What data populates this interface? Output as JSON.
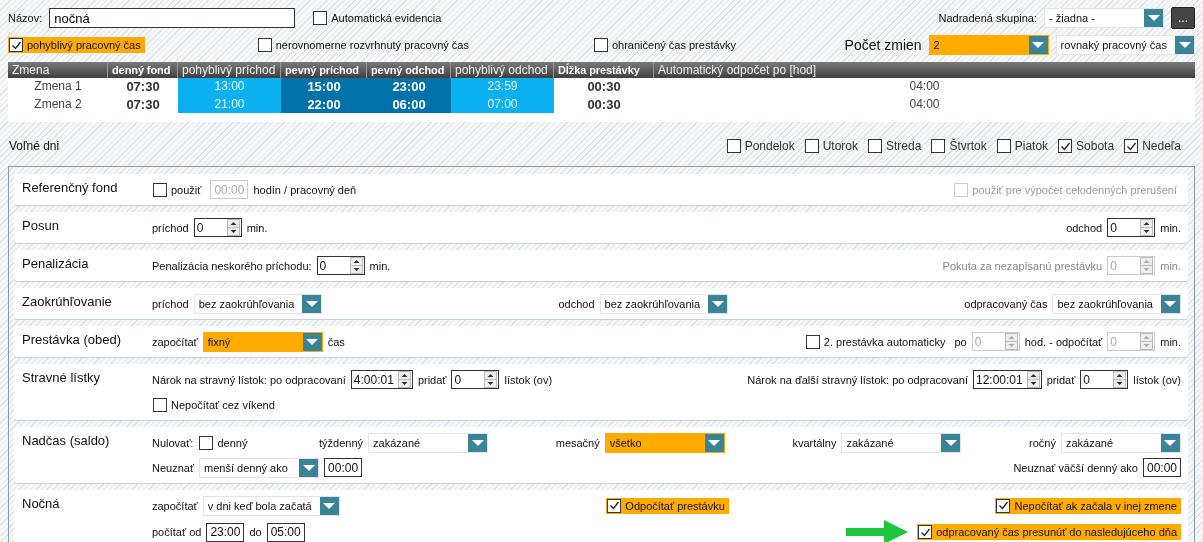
{
  "name_field": {
    "label": "Názov:",
    "value": "nočná"
  },
  "auto_evidence": {
    "label": "Automatická evidencia",
    "checked": false
  },
  "parent_group": {
    "label": "Nadradená skupina:",
    "select": {
      "value": "- žiadna -",
      "highlighted": false
    },
    "button": "..."
  },
  "options": [
    {
      "label": "pohyblivý pracovný čas",
      "checked": true,
      "highlighted": true
    },
    {
      "label": "nerovnomerne rozvrhnutý pracovný čas",
      "checked": false,
      "highlighted": false
    },
    {
      "label": "ohraničený čas prestávky",
      "checked": false,
      "highlighted": false
    }
  ],
  "shift_count": {
    "label": "Počet zmien",
    "selects": [
      {
        "value": "2",
        "highlighted": true
      },
      {
        "value": "rovnaký pracovný čas",
        "highlighted": false
      }
    ]
  },
  "shift_table": {
    "columns": [
      {
        "label": "Zmena",
        "kind": "plain",
        "bold": false
      },
      {
        "label": "denný fond",
        "kind": "plain",
        "bold": true
      },
      {
        "label": "pohyblivý príchod",
        "kind": "flexible",
        "bold": false
      },
      {
        "label": "pevný príchod",
        "kind": "fixed",
        "bold": true
      },
      {
        "label": "pevný odchod",
        "kind": "fixed",
        "bold": true
      },
      {
        "label": "pohyblivý odchod",
        "kind": "flexible",
        "bold": false
      },
      {
        "label": "Dĺžka prestávky",
        "kind": "plain",
        "bold": true
      },
      {
        "label": "Automatický odpočet po [hod]",
        "kind": "plain",
        "bold": false
      }
    ],
    "rows": [
      [
        "Zmena 1",
        "07:30",
        "13:00",
        "15:00",
        "23:00",
        "23:59",
        "00:30",
        "04:00"
      ],
      [
        "Zmena 2",
        "07:30",
        "21:00",
        "22:00",
        "06:00",
        "07:00",
        "00:30",
        "04:00"
      ]
    ]
  },
  "days_off": {
    "label": "Voľné dni",
    "days": [
      {
        "label": "Pondelok",
        "checked": false
      },
      {
        "label": "Utorok",
        "checked": false
      },
      {
        "label": "Streda",
        "checked": false
      },
      {
        "label": "Štvrtok",
        "checked": false
      },
      {
        "label": "Piatok",
        "checked": false
      },
      {
        "label": "Sobota",
        "checked": true
      },
      {
        "label": "Nedeľa",
        "checked": true
      }
    ]
  },
  "sections": [
    {
      "label": "Referenčný fond",
      "rows": [
        {
          "groups": [
            {
              "items": [
                {
                  "kind": "check",
                  "label": "použiť",
                  "checked": false,
                  "disabled": false,
                  "highlighted": false
                },
                {
                  "kind": "time",
                  "value": "00:00",
                  "disabled": true
                },
                {
                  "kind": "text",
                  "text": "hodín / pracovný deň"
                }
              ]
            },
            {
              "items": [
                {
                  "kind": "check",
                  "label": "použiť pre výpočet celodenných prerušení",
                  "checked": false,
                  "disabled": true,
                  "highlighted": false
                }
              ]
            }
          ]
        }
      ]
    },
    {
      "label": "Posun",
      "rows": [
        {
          "groups": [
            {
              "items": [
                {
                  "kind": "text",
                  "text": "príchod"
                },
                {
                  "kind": "spin",
                  "value": "0",
                  "disabled": false
                },
                {
                  "kind": "text",
                  "text": "min."
                }
              ]
            },
            {
              "items": [
                {
                  "kind": "text",
                  "text": "odchod"
                },
                {
                  "kind": "spin",
                  "value": "0",
                  "disabled": false
                },
                {
                  "kind": "text",
                  "text": "min."
                }
              ]
            }
          ]
        }
      ]
    },
    {
      "label": "Penalizácia",
      "rows": [
        {
          "groups": [
            {
              "items": [
                {
                  "kind": "text",
                  "text": "Penalizácia neskorého príchodu:"
                },
                {
                  "kind": "spin",
                  "value": "0",
                  "disabled": false
                },
                {
                  "kind": "text",
                  "text": "min."
                }
              ]
            },
            {
              "items": [
                {
                  "kind": "dimmed",
                  "text": "Pokuta za nezapísanú prestávku"
                },
                {
                  "kind": "spin",
                  "value": "0",
                  "disabled": true
                },
                {
                  "kind": "dimmed",
                  "text": "min."
                }
              ]
            }
          ]
        }
      ]
    },
    {
      "label": "Zaokrúhľovanie",
      "rows": [
        {
          "groups": [
            {
              "items": [
                {
                  "kind": "text",
                  "text": "príchod"
                },
                {
                  "kind": "select",
                  "value": "bez zaokrúhľovania",
                  "highlighted": false
                }
              ]
            },
            {
              "items": [
                {
                  "kind": "text",
                  "text": "odchod"
                },
                {
                  "kind": "select",
                  "value": "bez zaokrúhľovania",
                  "highlighted": false
                }
              ]
            },
            {
              "items": [
                {
                  "kind": "text",
                  "text": "odpracovaný čas"
                },
                {
                  "kind": "select",
                  "value": "bez zaokrúhľovania",
                  "highlighted": false
                }
              ]
            }
          ]
        }
      ]
    },
    {
      "label": "Prestávka (obed)",
      "rows": [
        {
          "groups": [
            {
              "items": [
                {
                  "kind": "text",
                  "text": "započítať"
                },
                {
                  "kind": "select",
                  "value": "fixný",
                  "highlighted": true
                },
                {
                  "kind": "text",
                  "text": "čas"
                }
              ]
            },
            {
              "items": [
                {
                  "kind": "check",
                  "label": "2. prestávka automaticky",
                  "checked": false,
                  "disabled": false,
                  "highlighted": false
                },
                {
                  "kind": "text",
                  "text": "po"
                },
                {
                  "kind": "spin",
                  "value": "0",
                  "disabled": true
                },
                {
                  "kind": "text",
                  "text": "hod. - odpočítať"
                },
                {
                  "kind": "spin",
                  "value": "0",
                  "disabled": true
                },
                {
                  "kind": "text",
                  "text": "min."
                }
              ]
            }
          ]
        }
      ]
    },
    {
      "label": "Stravné lístky",
      "rows": [
        {
          "groups": [
            {
              "items": [
                {
                  "kind": "text",
                  "text": "Nárok na stravný lístok: po odpracovaní"
                },
                {
                  "kind": "spin",
                  "value": "4:00:01",
                  "disabled": false
                },
                {
                  "kind": "text",
                  "text": "pridať"
                },
                {
                  "kind": "spin",
                  "value": "0",
                  "disabled": false
                },
                {
                  "kind": "text",
                  "text": "lístok (ov)"
                }
              ]
            },
            {
              "items": [
                {
                  "kind": "text",
                  "text": "Nárok na ďalší stravný lístok: po odpracovaní"
                },
                {
                  "kind": "spin",
                  "value": "12:00:01",
                  "disabled": false
                },
                {
                  "kind": "text",
                  "text": "pridať"
                },
                {
                  "kind": "spin",
                  "value": "0",
                  "disabled": false
                },
                {
                  "kind": "text",
                  "text": "lístok (ov)"
                }
              ]
            }
          ]
        },
        {
          "groups": [
            {
              "items": [
                {
                  "kind": "check",
                  "label": "Nepočítať cez víkend",
                  "checked": false,
                  "disabled": false,
                  "highlighted": false
                }
              ]
            }
          ]
        }
      ]
    },
    {
      "label": "Nadčas (saldo)",
      "rows": [
        {
          "groups": [
            {
              "items": [
                {
                  "kind": "text",
                  "text": "Nulovať:"
                },
                {
                  "kind": "check",
                  "label": "denný",
                  "checked": false,
                  "disabled": false,
                  "highlighted": false
                }
              ]
            },
            {
              "items": [
                {
                  "kind": "text",
                  "text": "týždenný"
                },
                {
                  "kind": "select",
                  "value": "zakázané",
                  "highlighted": false
                }
              ]
            },
            {
              "items": [
                {
                  "kind": "text",
                  "text": "mesačný"
                },
                {
                  "kind": "select",
                  "value": "všetko",
                  "highlighted": true
                }
              ]
            },
            {
              "items": [
                {
                  "kind": "text",
                  "text": "kvartálny"
                },
                {
                  "kind": "select",
                  "value": "zakázané",
                  "highlighted": false
                }
              ]
            },
            {
              "items": [
                {
                  "kind": "text",
                  "text": "ročný"
                },
                {
                  "kind": "select",
                  "value": "zakázané",
                  "highlighted": false
                }
              ]
            }
          ]
        },
        {
          "groups": [
            {
              "items": [
                {
                  "kind": "text",
                  "text": "Neuznať"
                },
                {
                  "kind": "select",
                  "value": "menší denný ako",
                  "highlighted": false
                },
                {
                  "kind": "time",
                  "value": "00:00",
                  "disabled": false
                }
              ]
            },
            {
              "items": [
                {
                  "kind": "text",
                  "text": "Neuznať väčší denný ako"
                },
                {
                  "kind": "time",
                  "value": "00:00",
                  "disabled": false
                }
              ]
            }
          ]
        }
      ]
    },
    {
      "label": "Nočná",
      "rows": [
        {
          "groups": [
            {
              "items": [
                {
                  "kind": "text",
                  "text": "započítať"
                },
                {
                  "kind": "select",
                  "value": "v dni keď bola začatá",
                  "highlighted": false
                }
              ]
            },
            {
              "items": [
                {
                  "kind": "check",
                  "label": "Odpočítať prestávku",
                  "checked": true,
                  "disabled": false,
                  "highlighted": true
                }
              ]
            },
            {
              "items": [
                {
                  "kind": "check",
                  "label": "Nepočítať ak začala v inej zmene",
                  "checked": true,
                  "disabled": false,
                  "highlighted": true
                }
              ]
            }
          ]
        },
        {
          "groups": [
            {
              "items": [
                {
                  "kind": "text",
                  "text": "počítať od"
                },
                {
                  "kind": "time",
                  "value": "23:00",
                  "disabled": false
                },
                {
                  "kind": "text",
                  "text": "do"
                },
                {
                  "kind": "time",
                  "value": "05:00",
                  "disabled": false
                }
              ]
            },
            {
              "items": [
                {
                  "kind": "arrow"
                },
                {
                  "kind": "check",
                  "label": "odpracovaný čas presunúť do nasledujúceho dňa",
                  "checked": true,
                  "disabled": false,
                  "highlighted": true
                }
              ]
            }
          ]
        }
      ]
    }
  ]
}
